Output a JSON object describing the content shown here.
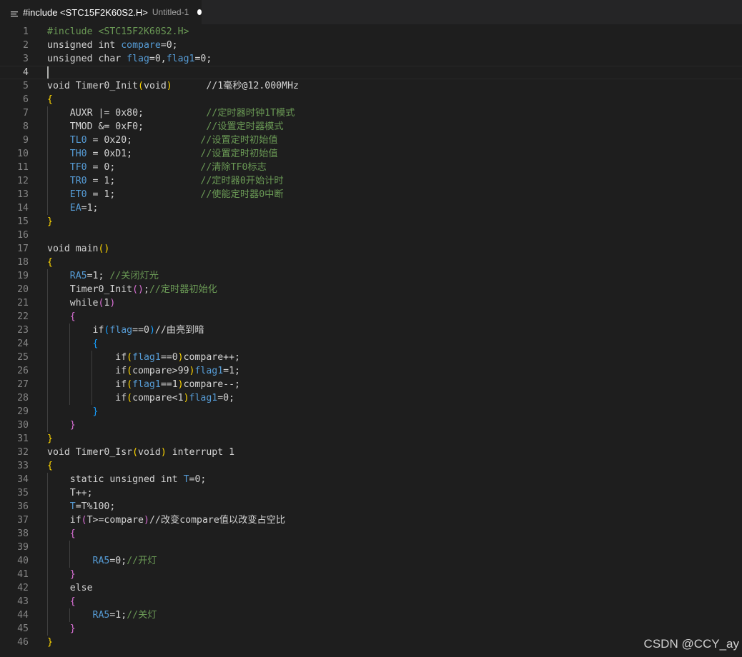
{
  "tab": {
    "title": "#include <STC15F2K60S2.H>",
    "description": "Untitled-1",
    "icon": "lines-icon",
    "dirty": true
  },
  "colors": {
    "background": "#1e1e1e",
    "default": "#d4d4d4",
    "variable": "#569cd6",
    "comment": "#6a9955",
    "bracket_gold": "#ffd700",
    "bracket_purple": "#da70d6",
    "bracket_blue": "#179fff",
    "line_number": "#858585"
  },
  "editor": {
    "current_line": 4,
    "lines": [
      {
        "n": "1",
        "tokens": [
          {
            "t": "#include <STC15F2K60S2.H>",
            "c": "comment"
          }
        ]
      },
      {
        "n": "2",
        "tokens": [
          {
            "t": "unsigned int ",
            "c": "default"
          },
          {
            "t": "compare",
            "c": "variable"
          },
          {
            "t": "=0;",
            "c": "default"
          }
        ]
      },
      {
        "n": "3",
        "tokens": [
          {
            "t": "unsigned char ",
            "c": "default"
          },
          {
            "t": "flag",
            "c": "variable"
          },
          {
            "t": "=0,",
            "c": "default"
          },
          {
            "t": "flag1",
            "c": "variable"
          },
          {
            "t": "=0;",
            "c": "default"
          }
        ]
      },
      {
        "n": "4",
        "tokens": []
      },
      {
        "n": "5",
        "tokens": [
          {
            "t": "void Timer0_Init",
            "c": "default"
          },
          {
            "t": "(",
            "c": "bracket_gold"
          },
          {
            "t": "void",
            "c": "default"
          },
          {
            "t": ")",
            "c": "bracket_gold"
          },
          {
            "t": "      //1毫秒@12.000MHz",
            "c": "default"
          }
        ]
      },
      {
        "n": "6",
        "tokens": [
          {
            "t": "{",
            "c": "bracket_gold"
          }
        ]
      },
      {
        "n": "7",
        "tokens": [
          {
            "t": "    AUXR |= 0x80;           ",
            "c": "default"
          },
          {
            "t": "//定时器时钟1T模式",
            "c": "comment"
          }
        ]
      },
      {
        "n": "8",
        "tokens": [
          {
            "t": "    TMOD &= 0xF0;           ",
            "c": "default"
          },
          {
            "t": "//设置定时器模式",
            "c": "comment"
          }
        ]
      },
      {
        "n": "9",
        "tokens": [
          {
            "t": "    ",
            "c": "default"
          },
          {
            "t": "TL0",
            "c": "variable"
          },
          {
            "t": " = 0x20;            ",
            "c": "default"
          },
          {
            "t": "//设置定时初始值",
            "c": "comment"
          }
        ]
      },
      {
        "n": "10",
        "tokens": [
          {
            "t": "    ",
            "c": "default"
          },
          {
            "t": "TH0",
            "c": "variable"
          },
          {
            "t": " = 0xD1;            ",
            "c": "default"
          },
          {
            "t": "//设置定时初始值",
            "c": "comment"
          }
        ]
      },
      {
        "n": "11",
        "tokens": [
          {
            "t": "    ",
            "c": "default"
          },
          {
            "t": "TF0",
            "c": "variable"
          },
          {
            "t": " = 0;               ",
            "c": "default"
          },
          {
            "t": "//清除TF0标志",
            "c": "comment"
          }
        ]
      },
      {
        "n": "12",
        "tokens": [
          {
            "t": "    ",
            "c": "default"
          },
          {
            "t": "TR0",
            "c": "variable"
          },
          {
            "t": " = 1;               ",
            "c": "default"
          },
          {
            "t": "//定时器0开始计时",
            "c": "comment"
          }
        ]
      },
      {
        "n": "13",
        "tokens": [
          {
            "t": "    ",
            "c": "default"
          },
          {
            "t": "ET0",
            "c": "variable"
          },
          {
            "t": " = 1;               ",
            "c": "default"
          },
          {
            "t": "//使能定时器0中断",
            "c": "comment"
          }
        ]
      },
      {
        "n": "14",
        "tokens": [
          {
            "t": "    ",
            "c": "default"
          },
          {
            "t": "EA",
            "c": "variable"
          },
          {
            "t": "=1;",
            "c": "default"
          }
        ]
      },
      {
        "n": "15",
        "tokens": [
          {
            "t": "}",
            "c": "bracket_gold"
          }
        ]
      },
      {
        "n": "16",
        "tokens": []
      },
      {
        "n": "17",
        "tokens": [
          {
            "t": "void main",
            "c": "default"
          },
          {
            "t": "()",
            "c": "bracket_gold"
          }
        ]
      },
      {
        "n": "18",
        "tokens": [
          {
            "t": "{",
            "c": "bracket_gold"
          }
        ]
      },
      {
        "n": "19",
        "tokens": [
          {
            "t": "    ",
            "c": "default"
          },
          {
            "t": "RA5",
            "c": "variable"
          },
          {
            "t": "=1; ",
            "c": "default"
          },
          {
            "t": "//关闭灯光",
            "c": "comment"
          }
        ]
      },
      {
        "n": "20",
        "tokens": [
          {
            "t": "    Timer0_Init",
            "c": "default"
          },
          {
            "t": "()",
            "c": "bracket_purple"
          },
          {
            "t": ";",
            "c": "default"
          },
          {
            "t": "//定时器初始化",
            "c": "comment"
          }
        ]
      },
      {
        "n": "21",
        "tokens": [
          {
            "t": "    while",
            "c": "default"
          },
          {
            "t": "(",
            "c": "bracket_purple"
          },
          {
            "t": "1",
            "c": "default"
          },
          {
            "t": ")",
            "c": "bracket_purple"
          }
        ]
      },
      {
        "n": "22",
        "tokens": [
          {
            "t": "    ",
            "c": "default"
          },
          {
            "t": "{",
            "c": "bracket_purple"
          }
        ]
      },
      {
        "n": "23",
        "tokens": [
          {
            "t": "        if",
            "c": "default"
          },
          {
            "t": "(",
            "c": "bracket_blue"
          },
          {
            "t": "flag",
            "c": "variable"
          },
          {
            "t": "==0",
            "c": "default"
          },
          {
            "t": ")",
            "c": "bracket_blue"
          },
          {
            "t": "//由亮到暗",
            "c": "default"
          }
        ]
      },
      {
        "n": "24",
        "tokens": [
          {
            "t": "        ",
            "c": "default"
          },
          {
            "t": "{",
            "c": "bracket_blue"
          }
        ]
      },
      {
        "n": "25",
        "tokens": [
          {
            "t": "            if",
            "c": "default"
          },
          {
            "t": "(",
            "c": "bracket_gold"
          },
          {
            "t": "flag1",
            "c": "variable"
          },
          {
            "t": "==0",
            "c": "default"
          },
          {
            "t": ")",
            "c": "bracket_gold"
          },
          {
            "t": "compare++;",
            "c": "default"
          }
        ]
      },
      {
        "n": "26",
        "tokens": [
          {
            "t": "            if",
            "c": "default"
          },
          {
            "t": "(",
            "c": "bracket_gold"
          },
          {
            "t": "compare>99",
            "c": "default"
          },
          {
            "t": ")",
            "c": "bracket_gold"
          },
          {
            "t": "flag1",
            "c": "variable"
          },
          {
            "t": "=1;",
            "c": "default"
          }
        ]
      },
      {
        "n": "27",
        "tokens": [
          {
            "t": "            if",
            "c": "default"
          },
          {
            "t": "(",
            "c": "bracket_gold"
          },
          {
            "t": "flag1",
            "c": "variable"
          },
          {
            "t": "==1",
            "c": "default"
          },
          {
            "t": ")",
            "c": "bracket_gold"
          },
          {
            "t": "compare--;",
            "c": "default"
          }
        ]
      },
      {
        "n": "28",
        "tokens": [
          {
            "t": "            if",
            "c": "default"
          },
          {
            "t": "(",
            "c": "bracket_gold"
          },
          {
            "t": "compare<1",
            "c": "default"
          },
          {
            "t": ")",
            "c": "bracket_gold"
          },
          {
            "t": "flag1",
            "c": "variable"
          },
          {
            "t": "=0;",
            "c": "default"
          }
        ]
      },
      {
        "n": "29",
        "tokens": [
          {
            "t": "        ",
            "c": "default"
          },
          {
            "t": "}",
            "c": "bracket_blue"
          }
        ]
      },
      {
        "n": "30",
        "tokens": [
          {
            "t": "    ",
            "c": "default"
          },
          {
            "t": "}",
            "c": "bracket_purple"
          }
        ]
      },
      {
        "n": "31",
        "tokens": [
          {
            "t": "}",
            "c": "bracket_gold"
          }
        ]
      },
      {
        "n": "32",
        "tokens": [
          {
            "t": "void Timer0_Isr",
            "c": "default"
          },
          {
            "t": "(",
            "c": "bracket_gold"
          },
          {
            "t": "void",
            "c": "default"
          },
          {
            "t": ")",
            "c": "bracket_gold"
          },
          {
            "t": " interrupt 1",
            "c": "default"
          }
        ]
      },
      {
        "n": "33",
        "tokens": [
          {
            "t": "{",
            "c": "bracket_gold"
          }
        ]
      },
      {
        "n": "34",
        "tokens": [
          {
            "t": "    static unsigned int ",
            "c": "default"
          },
          {
            "t": "T",
            "c": "variable"
          },
          {
            "t": "=0;",
            "c": "default"
          }
        ]
      },
      {
        "n": "35",
        "tokens": [
          {
            "t": "    T++;",
            "c": "default"
          }
        ]
      },
      {
        "n": "36",
        "tokens": [
          {
            "t": "    ",
            "c": "default"
          },
          {
            "t": "T",
            "c": "variable"
          },
          {
            "t": "=T%100;",
            "c": "default"
          }
        ]
      },
      {
        "n": "37",
        "tokens": [
          {
            "t": "    if",
            "c": "default"
          },
          {
            "t": "(",
            "c": "bracket_purple"
          },
          {
            "t": "T>=compare",
            "c": "default"
          },
          {
            "t": ")",
            "c": "bracket_purple"
          },
          {
            "t": "//改变compare值以改变占空比",
            "c": "default"
          }
        ]
      },
      {
        "n": "38",
        "tokens": [
          {
            "t": "    ",
            "c": "default"
          },
          {
            "t": "{",
            "c": "bracket_purple"
          }
        ]
      },
      {
        "n": "39",
        "tokens": []
      },
      {
        "n": "40",
        "tokens": [
          {
            "t": "        ",
            "c": "default"
          },
          {
            "t": "RA5",
            "c": "variable"
          },
          {
            "t": "=0;",
            "c": "default"
          },
          {
            "t": "//开灯",
            "c": "comment"
          }
        ]
      },
      {
        "n": "41",
        "tokens": [
          {
            "t": "    ",
            "c": "default"
          },
          {
            "t": "}",
            "c": "bracket_purple"
          }
        ]
      },
      {
        "n": "42",
        "tokens": [
          {
            "t": "    else",
            "c": "default"
          }
        ]
      },
      {
        "n": "43",
        "tokens": [
          {
            "t": "    ",
            "c": "default"
          },
          {
            "t": "{",
            "c": "bracket_purple"
          }
        ]
      },
      {
        "n": "44",
        "tokens": [
          {
            "t": "        ",
            "c": "default"
          },
          {
            "t": "RA5",
            "c": "variable"
          },
          {
            "t": "=1;",
            "c": "default"
          },
          {
            "t": "//关灯",
            "c": "comment"
          }
        ]
      },
      {
        "n": "45",
        "tokens": [
          {
            "t": "    ",
            "c": "default"
          },
          {
            "t": "}",
            "c": "bracket_purple"
          }
        ]
      },
      {
        "n": "46",
        "tokens": [
          {
            "t": "}",
            "c": "bracket_gold"
          }
        ]
      }
    ]
  },
  "watermark": "CSDN @CCY_ay"
}
